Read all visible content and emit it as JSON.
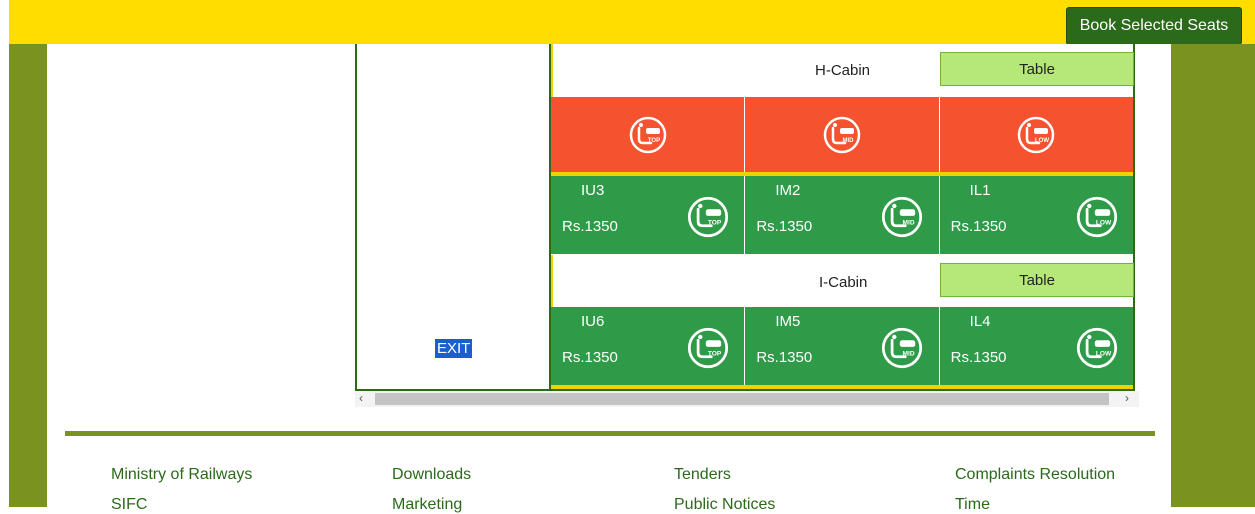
{
  "header": {
    "book_label": "Book Selected Seats"
  },
  "panel": {
    "exit_label": "EXIT"
  },
  "cabins": [
    {
      "name": "H-Cabin",
      "table_label": "Table"
    },
    {
      "name": "I-Cabin",
      "table_label": "Table"
    }
  ],
  "booked_row": [
    {
      "berth": "TOP"
    },
    {
      "berth": "MID"
    },
    {
      "berth": "LOW"
    }
  ],
  "seats_row1": [
    {
      "code": "IU3",
      "price": "Rs.1350",
      "berth": "TOP"
    },
    {
      "code": "IM2",
      "price": "Rs.1350",
      "berth": "MID"
    },
    {
      "code": "IL1",
      "price": "Rs.1350",
      "berth": "LOW"
    }
  ],
  "seats_row2": [
    {
      "code": "IU6",
      "price": "Rs.1350",
      "berth": "TOP"
    },
    {
      "code": "IM5",
      "price": "Rs.1350",
      "berth": "MID"
    },
    {
      "code": "IL4",
      "price": "Rs.1350",
      "berth": "LOW"
    }
  ],
  "footer": {
    "links": [
      "Ministry of Railways",
      "Downloads",
      "Tenders",
      "Complaints Resolution",
      "SIFC",
      "Marketing",
      "Public Notices",
      "Time"
    ]
  },
  "colors": {
    "yellow": "#ffdd00",
    "olive": "#7a9220",
    "booked": "#f55230",
    "available": "#2f9a48",
    "table": "#b5e878"
  },
  "icons": {
    "berth": "berth-seat-icon",
    "scroll_left": "chevron-left-icon",
    "scroll_right": "chevron-right-icon"
  }
}
